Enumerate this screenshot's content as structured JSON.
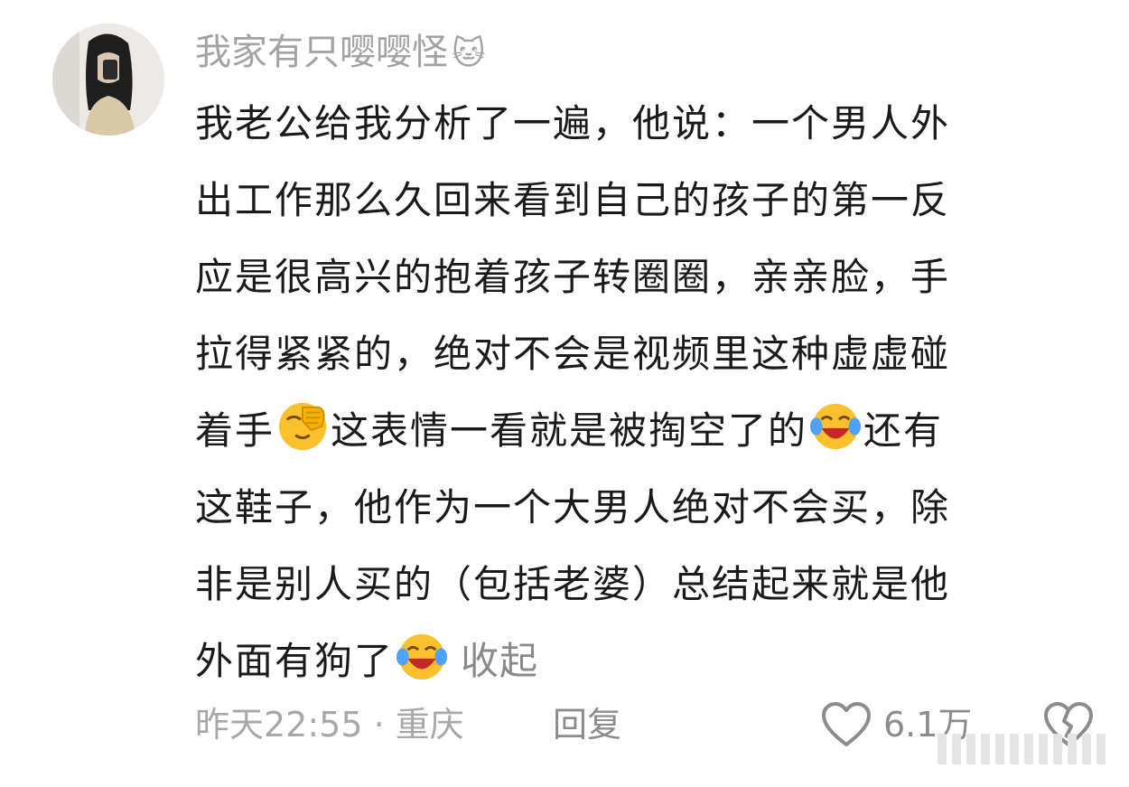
{
  "comment": {
    "username": "我家有只嘤嘤怪",
    "username_emoji": "🐱",
    "lines": [
      "我老公给我分析了一遍，他说：一个男人外",
      "出工作那么久回来看到自己的孩子的第一反",
      "应是很高兴的抱着孩子转圈圈，亲亲脸，手",
      "拉得紧紧的，绝对不会是视频里这种虚虚碰"
    ],
    "line5_part1": "着手",
    "line5_part2": "这表情一看就是被掏空了的",
    "line5_part3": "还有",
    "lines_b": [
      "这鞋子，他作为一个大男人绝对不会买，除",
      "非是别人买的（包括老婆）总结起来就是他"
    ],
    "line8": "外面有狗了",
    "collapse_label": "收起",
    "emoji_facepalm": "facepalm-emoji",
    "emoji_laugh": "laughing-tears-emoji"
  },
  "footer": {
    "time_location": "昨天22:55 · 重庆",
    "reply_label": "回复",
    "like_count": "6.1万",
    "like_icon": "heart-outline-icon",
    "dislike_icon": "broken-heart-outline-icon"
  },
  "colors": {
    "text": "#1a1a1a",
    "muted": "#a3a3a3",
    "action": "#8c8c8c",
    "emoji_yellow": "#fbc02d"
  }
}
